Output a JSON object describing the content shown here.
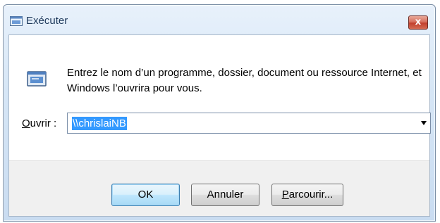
{
  "window": {
    "title": "Exécuter",
    "close_label": "x",
    "title_icon": "run-dialog-icon"
  },
  "dialog": {
    "icon": "run-dialog-icon",
    "description": "Entrez le nom d’un programme, dossier, document ou ressource Internet, et Windows l’ouvrira pour vous.",
    "open_label_mnemonic": "O",
    "open_label_rest": "uvrir :",
    "open_value": "\\\\chrislaiNB"
  },
  "buttons": {
    "ok": "OK",
    "cancel": "Annuler",
    "browse_mnemonic": "P",
    "browse_rest": "arcourir..."
  },
  "colors": {
    "selection": "#3399ff",
    "close_button": "#c2402e",
    "title_text": "#1e395b"
  }
}
